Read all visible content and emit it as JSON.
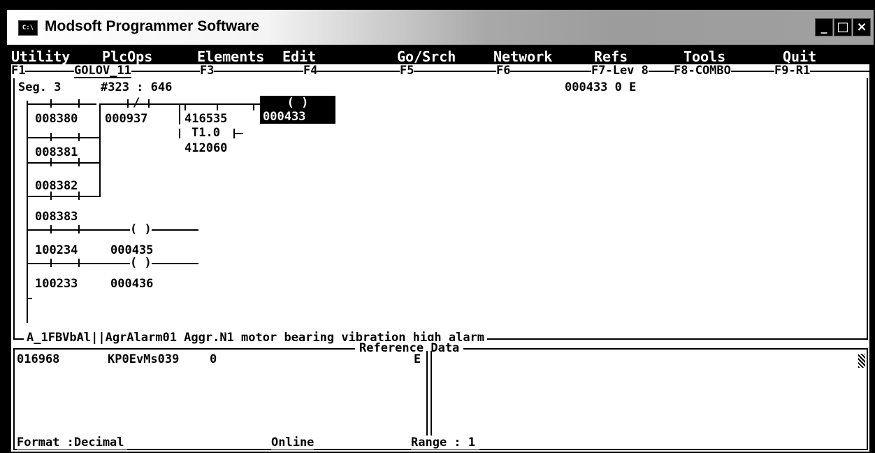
{
  "window": {
    "title": "Modsoft Programmer Software",
    "icon_label": "C:\\",
    "minimize_glyph": "_",
    "maximize_glyph": "□",
    "close_glyph": "×"
  },
  "menu": [
    "Utility",
    "PlcOps",
    "Elements",
    "Edit",
    "Go/Srch",
    "Network",
    "Refs",
    "Tools",
    "Quit"
  ],
  "fkeys": [
    "F1",
    "GOLOV_11",
    "F3",
    "F4",
    "F5",
    "F6",
    "F7-Lev 8",
    "F8-COMBO",
    "F9-R1"
  ],
  "ladder": {
    "seg": "Seg. 3",
    "network": "#323 : 646",
    "status_ref": "000433 0 E",
    "contacts": {
      "c1": "008380",
      "c2": "000937",
      "c3": "416535",
      "coil_main": "000433",
      "timer": "T1.0",
      "timer_ref": "412060",
      "c4": "008381",
      "c5": "008382",
      "c6": "008383",
      "c7": "100234",
      "coil2": "000435",
      "c8": "100233",
      "coil3": "000436"
    },
    "coil_symbol": "( )",
    "nc_symbol": "/",
    "description": "A_1FBVbAl||AgrAlarm01 Aggr.N1 motor bearing vibration high alarm"
  },
  "reference": {
    "title": "Reference Data",
    "address": "016968",
    "symbol": "KP0EvMs039",
    "value": "0",
    "flag": "E",
    "format_label": "Format :Decimal",
    "mode": "Online",
    "range_label": "Range : 1"
  }
}
